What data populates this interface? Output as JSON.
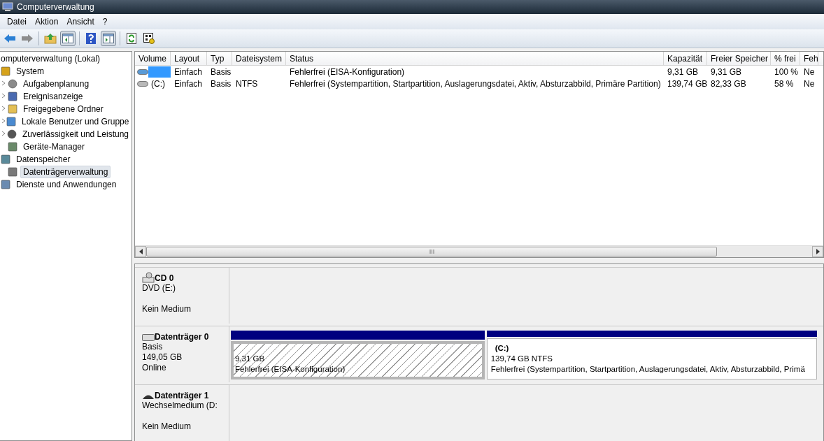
{
  "window": {
    "title": "Computerverwaltung"
  },
  "menu": [
    "Datei",
    "Aktion",
    "Ansicht",
    "?"
  ],
  "toolbar": [
    {
      "kind": "back",
      "disabled": false
    },
    {
      "kind": "forward",
      "disabled": true
    },
    {
      "kind": "sep"
    },
    {
      "kind": "up"
    },
    {
      "kind": "tree",
      "pressed": true
    },
    {
      "kind": "sep"
    },
    {
      "kind": "help"
    },
    {
      "kind": "pane",
      "pressed": true
    },
    {
      "kind": "sep"
    },
    {
      "kind": "refresh"
    },
    {
      "kind": "props"
    }
  ],
  "tree": {
    "root": "omputerverwaltung (Lokal)",
    "items": [
      {
        "label": "System",
        "selected": false,
        "children": [
          {
            "label": "Aufgabenplanung",
            "collapsed": true,
            "selected": false
          },
          {
            "label": "Ereignisanzeige",
            "collapsed": true,
            "selected": false
          },
          {
            "label": "Freigegebene Ordner",
            "collapsed": true,
            "selected": false
          },
          {
            "label": "Lokale Benutzer und Gruppe",
            "collapsed": true,
            "selected": false
          },
          {
            "label": "Zuverlässigkeit und Leistung",
            "collapsed": true,
            "selected": false
          },
          {
            "label": "Geräte-Manager",
            "collapsed": false,
            "selected": false
          }
        ]
      },
      {
        "label": "Datenspeicher",
        "selected": false,
        "children": [
          {
            "label": "Datenträgerverwaltung",
            "collapsed": false,
            "selected": true
          }
        ]
      },
      {
        "label": "Dienste und Anwendungen",
        "selected": false
      }
    ]
  },
  "table": {
    "columns": [
      "Volume",
      "Layout",
      "Typ",
      "Dateisystem",
      "Status",
      "Kapazität",
      "Freier Speicher",
      "% frei",
      "Feh"
    ],
    "rows": [
      {
        "selected": true,
        "cells": [
          "",
          "Einfach",
          "Basis",
          "",
          "Fehlerfrei (EISA-Konfiguration)",
          "9,31 GB",
          "9,31 GB",
          "100 %",
          "Ne"
        ]
      },
      {
        "selected": false,
        "cells": [
          "(C:)",
          "Einfach",
          "Basis",
          "NTFS",
          "Fehlerfrei (Systempartition, Startpartition, Auslagerungsdatei, Aktiv, Absturzabbild, Primäre Partition)",
          "139,74 GB",
          "82,33 GB",
          "58 %",
          "Ne"
        ]
      }
    ]
  },
  "disks": [
    {
      "kind": "cd",
      "name": "CD 0",
      "lines": [
        "DVD (E:)"
      ],
      "status": "Kein Medium"
    },
    {
      "kind": "disk",
      "name": "Datenträger 0",
      "lines": [
        "Basis",
        "149,05 GB",
        "Online"
      ],
      "partitions": [
        {
          "selected": true,
          "size": "9,31 GB",
          "status": "Fehlerfrei (EISA-Konfiguration)"
        },
        {
          "selected": false,
          "label": "(C:)",
          "size": "139,74 GB NTFS",
          "status": "Fehlerfrei (Systempartition, Startpartition, Auslagerungsdatei, Aktiv, Absturzabbild, Primä"
        }
      ]
    },
    {
      "kind": "removable",
      "name": "Datenträger 1",
      "lines": [
        "Wechselmedium (D:"
      ],
      "status": "Kein Medium"
    }
  ]
}
